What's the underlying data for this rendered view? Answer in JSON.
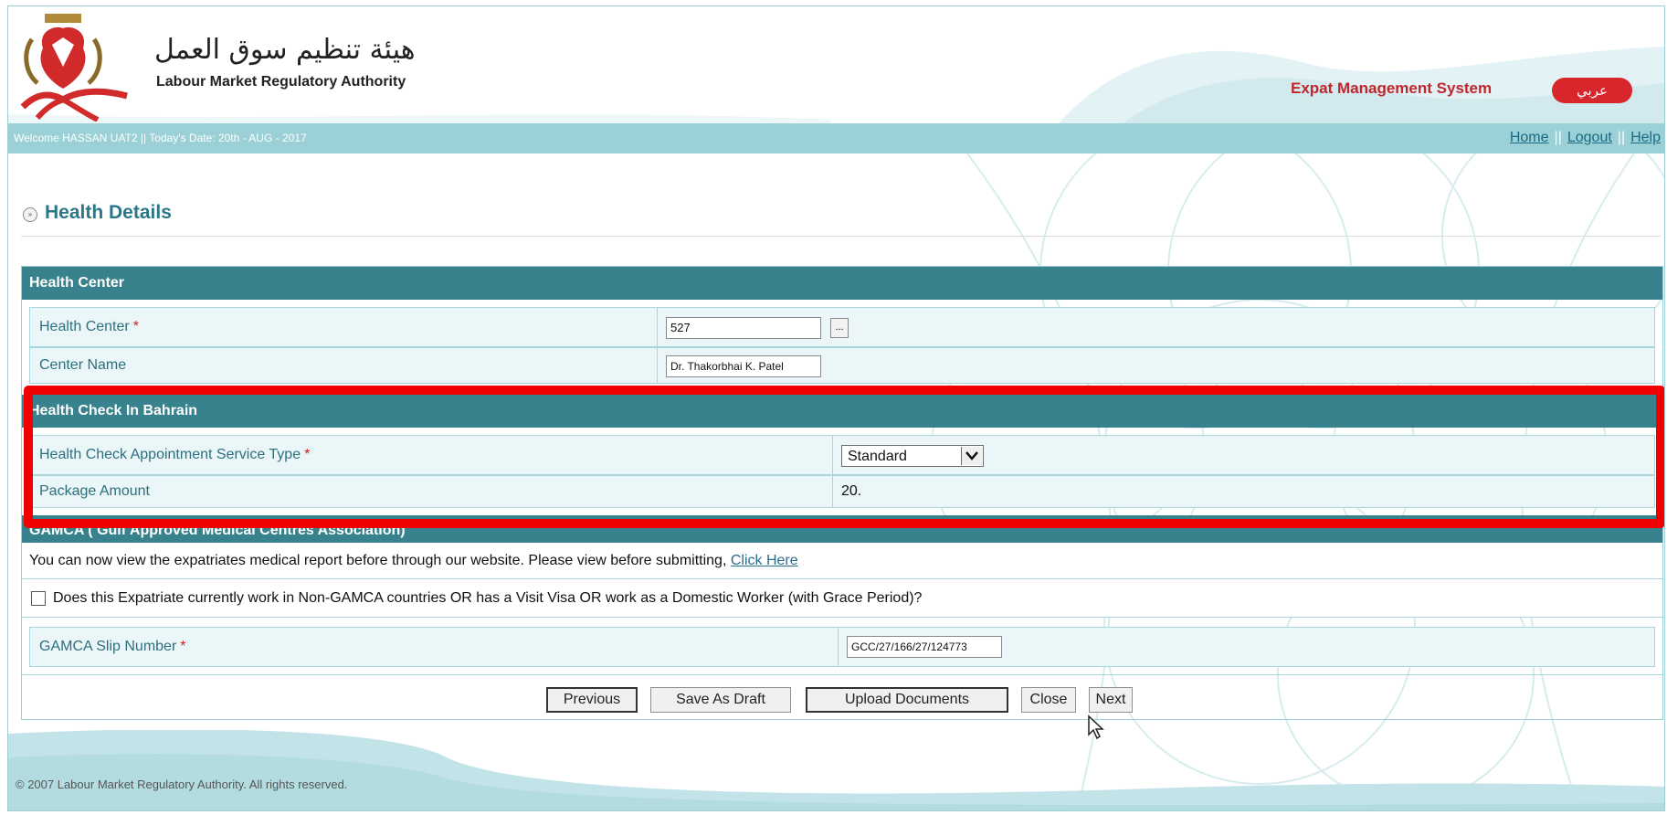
{
  "header": {
    "logo_arabic": "هيئة تنظيم سوق العمل",
    "logo_english": "Labour Market Regulatory Authority",
    "system_title": "Expat Management System",
    "language_toggle": "عربي"
  },
  "info_bar": {
    "welcome": "Welcome HASSAN UAT2  ||  Today's Date: 20th - AUG - 2017",
    "links": {
      "home": "Home",
      "logout": "Logout",
      "help": "Help"
    },
    "separator": "||"
  },
  "page": {
    "title": "Health Details"
  },
  "health_center": {
    "section_title": "Health Center",
    "health_center_label": "Health Center",
    "health_center_value": "527",
    "lookup_label": "...",
    "center_name_label": "Center Name",
    "center_name_value": "Dr. Thakorbhai K. Patel"
  },
  "health_check": {
    "section_title": "Health Check In Bahrain",
    "service_type_label": "Health Check Appointment Service Type",
    "service_type_value": "Standard",
    "package_amount_label": "Package Amount",
    "package_amount_value": "20."
  },
  "gamca": {
    "section_title": "GAMCA ( Gulf Approved Medical Centres Association)",
    "info_text": "You can now view the expatriates medical report before through our website. Please view before submitting,",
    "info_link": "Click Here",
    "checkbox_label": "Does this Expatriate currently work in Non-GAMCA countries OR has a Visit Visa OR work as a Domestic Worker (with Grace Period)?",
    "slip_label": "GAMCA Slip Number",
    "slip_value": "GCC/27/166/27/124773"
  },
  "required_marker": "*",
  "buttons": {
    "previous": "Previous",
    "save_draft": "Save As Draft",
    "upload": "Upload Documents",
    "close": "Close",
    "next": "Next"
  },
  "footer": {
    "copyright": "© 2007 Labour Market Regulatory Authority. All rights reserved."
  },
  "colors": {
    "section_header": "#37828c",
    "info_bar": "#9ad0d6",
    "highlight": "#f10000",
    "brand_red": "#c0262d"
  }
}
